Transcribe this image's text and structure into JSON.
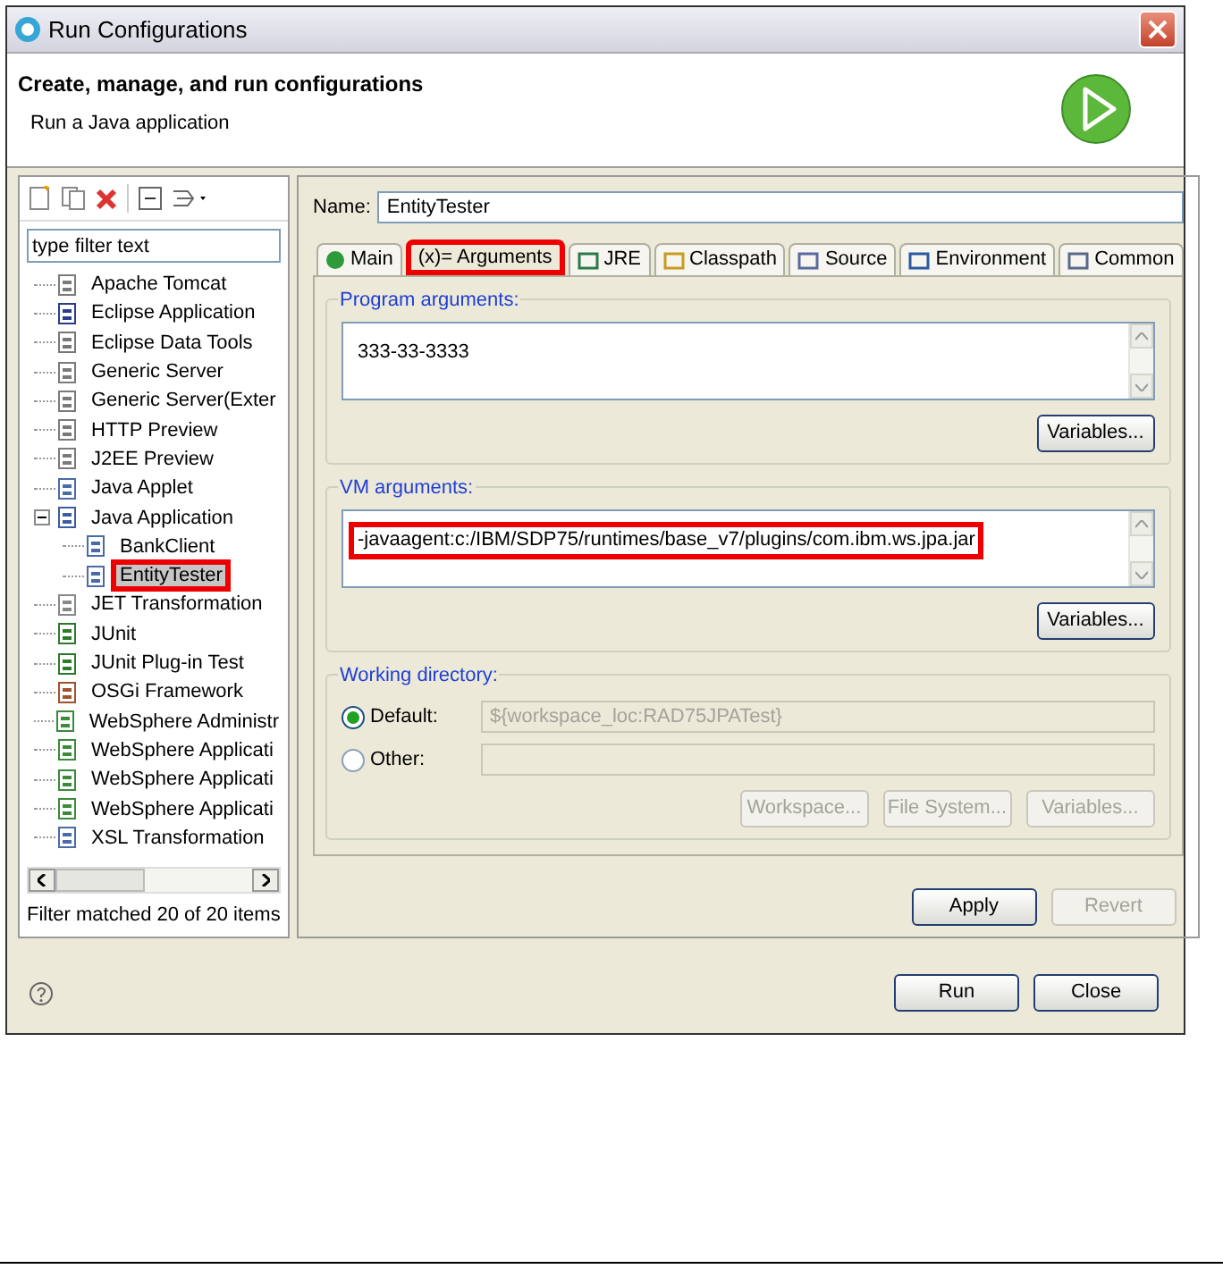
{
  "window": {
    "title": "Run Configurations"
  },
  "header": {
    "title": "Create, manage, and run configurations",
    "subtitle": "Run a Java application"
  },
  "filter": {
    "placeholder": "type filter text"
  },
  "tree": [
    {
      "label": "Apache Tomcat",
      "selected": false,
      "highlighted": false
    },
    {
      "label": "Eclipse Application",
      "selected": false,
      "highlighted": false
    },
    {
      "label": "Eclipse Data Tools",
      "selected": false,
      "highlighted": false
    },
    {
      "label": "Generic Server",
      "selected": false,
      "highlighted": false
    },
    {
      "label": "Generic Server(Exter",
      "selected": false,
      "highlighted": false
    },
    {
      "label": "HTTP Preview",
      "selected": false,
      "highlighted": false
    },
    {
      "label": "J2EE Preview",
      "selected": false,
      "highlighted": false
    },
    {
      "label": "Java Applet",
      "selected": false,
      "highlighted": false
    },
    {
      "label": "Java Application",
      "selected": false,
      "highlighted": false,
      "expanded": true,
      "children": [
        {
          "label": "BankClient",
          "selected": false,
          "highlighted": false
        },
        {
          "label": "EntityTester",
          "selected": true,
          "highlighted": true
        }
      ]
    },
    {
      "label": "JET Transformation",
      "selected": false,
      "highlighted": false
    },
    {
      "label": "JUnit",
      "selected": false,
      "highlighted": false
    },
    {
      "label": "JUnit Plug-in Test",
      "selected": false,
      "highlighted": false
    },
    {
      "label": "OSGi Framework",
      "selected": false,
      "highlighted": false
    },
    {
      "label": "WebSphere Administr",
      "selected": false,
      "highlighted": false
    },
    {
      "label": "WebSphere Applicati",
      "selected": false,
      "highlighted": false
    },
    {
      "label": "WebSphere Applicati",
      "selected": false,
      "highlighted": false
    },
    {
      "label": "WebSphere Applicati",
      "selected": false,
      "highlighted": false
    },
    {
      "label": "XSL Transformation",
      "selected": false,
      "highlighted": false
    }
  ],
  "filter_status": "Filter matched 20 of 20 items",
  "name": {
    "label": "Name:",
    "value": "EntityTester"
  },
  "tabs": [
    {
      "label": "Main",
      "selected": false,
      "highlighted": false
    },
    {
      "label": "(x)= Arguments",
      "selected": true,
      "highlighted": true
    },
    {
      "label": "JRE",
      "selected": false,
      "highlighted": false
    },
    {
      "label": "Classpath",
      "selected": false,
      "highlighted": false
    },
    {
      "label": "Source",
      "selected": false,
      "highlighted": false
    },
    {
      "label": "Environment",
      "selected": false,
      "highlighted": false
    },
    {
      "label": "Common",
      "selected": false,
      "highlighted": false
    }
  ],
  "program_arguments": {
    "label": "Program arguments:",
    "value": "333-33-3333",
    "button": "Variables..."
  },
  "vm_arguments": {
    "label": "VM arguments:",
    "value": "-javaagent:c:/IBM/SDP75/runtimes/base_v7/plugins/com.ibm.ws.jpa.jar",
    "highlighted": true,
    "button": "Variables..."
  },
  "working_directory": {
    "label": "Working directory:",
    "options": [
      {
        "label": "Default:",
        "selected": true,
        "value": "${workspace_loc:RAD75JPATest}"
      },
      {
        "label": "Other:",
        "selected": false
      }
    ],
    "buttons": [
      {
        "label": "Workspace...",
        "disabled": true
      },
      {
        "label": "File System...",
        "disabled": true
      },
      {
        "label": "Variables...",
        "disabled": true
      }
    ]
  },
  "actions": [
    {
      "label": "Apply",
      "disabled": false
    },
    {
      "label": "Revert",
      "disabled": true
    }
  ],
  "footer_buttons": [
    {
      "label": "Run",
      "disabled": false
    },
    {
      "label": "Close",
      "disabled": false
    }
  ]
}
